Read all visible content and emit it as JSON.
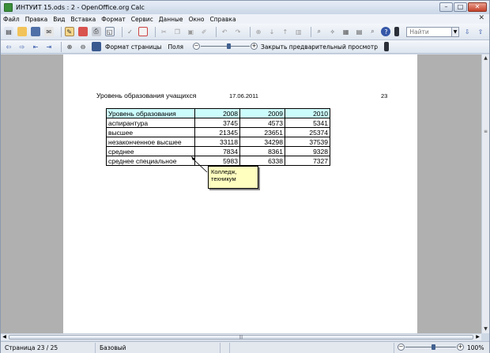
{
  "window": {
    "title": "ИНТУИТ 15.ods : 2 - OpenOffice.org Calc",
    "minimize": "–",
    "maximize": "□",
    "close": "✕"
  },
  "menu": [
    "Файл",
    "Правка",
    "Вид",
    "Вставка",
    "Формат",
    "Сервис",
    "Данные",
    "Окно",
    "Справка"
  ],
  "menu_close": "✕",
  "toolbar": {
    "find_placeholder": "Найти",
    "format_page": "Формат страницы",
    "margins": "Поля",
    "close_preview": "Закрыть предварительный просмотр"
  },
  "report": {
    "title": "Уровень образования учащихся",
    "date": "17.06.2011",
    "page_number": "23",
    "header": [
      "Уровень образования",
      "2008",
      "2009",
      "2010"
    ],
    "rows": [
      [
        "аспирантура",
        "3745",
        "4573",
        "5341"
      ],
      [
        "высшее",
        "21345",
        "23651",
        "25374"
      ],
      [
        "незаконченное высшее",
        "33118",
        "34298",
        "37539"
      ],
      [
        "среднее",
        "7834",
        "8361",
        "9328"
      ],
      [
        "среднее специальное",
        "5983",
        "6338",
        "7327"
      ]
    ],
    "comment": "Колледж, техникум"
  },
  "status": {
    "page": "Страница 23 / 25",
    "style": "Базовый",
    "zoom": "100%"
  },
  "colors": {
    "header_fill": "#ccfdfd",
    "comment_fill": "#ffffc0"
  }
}
